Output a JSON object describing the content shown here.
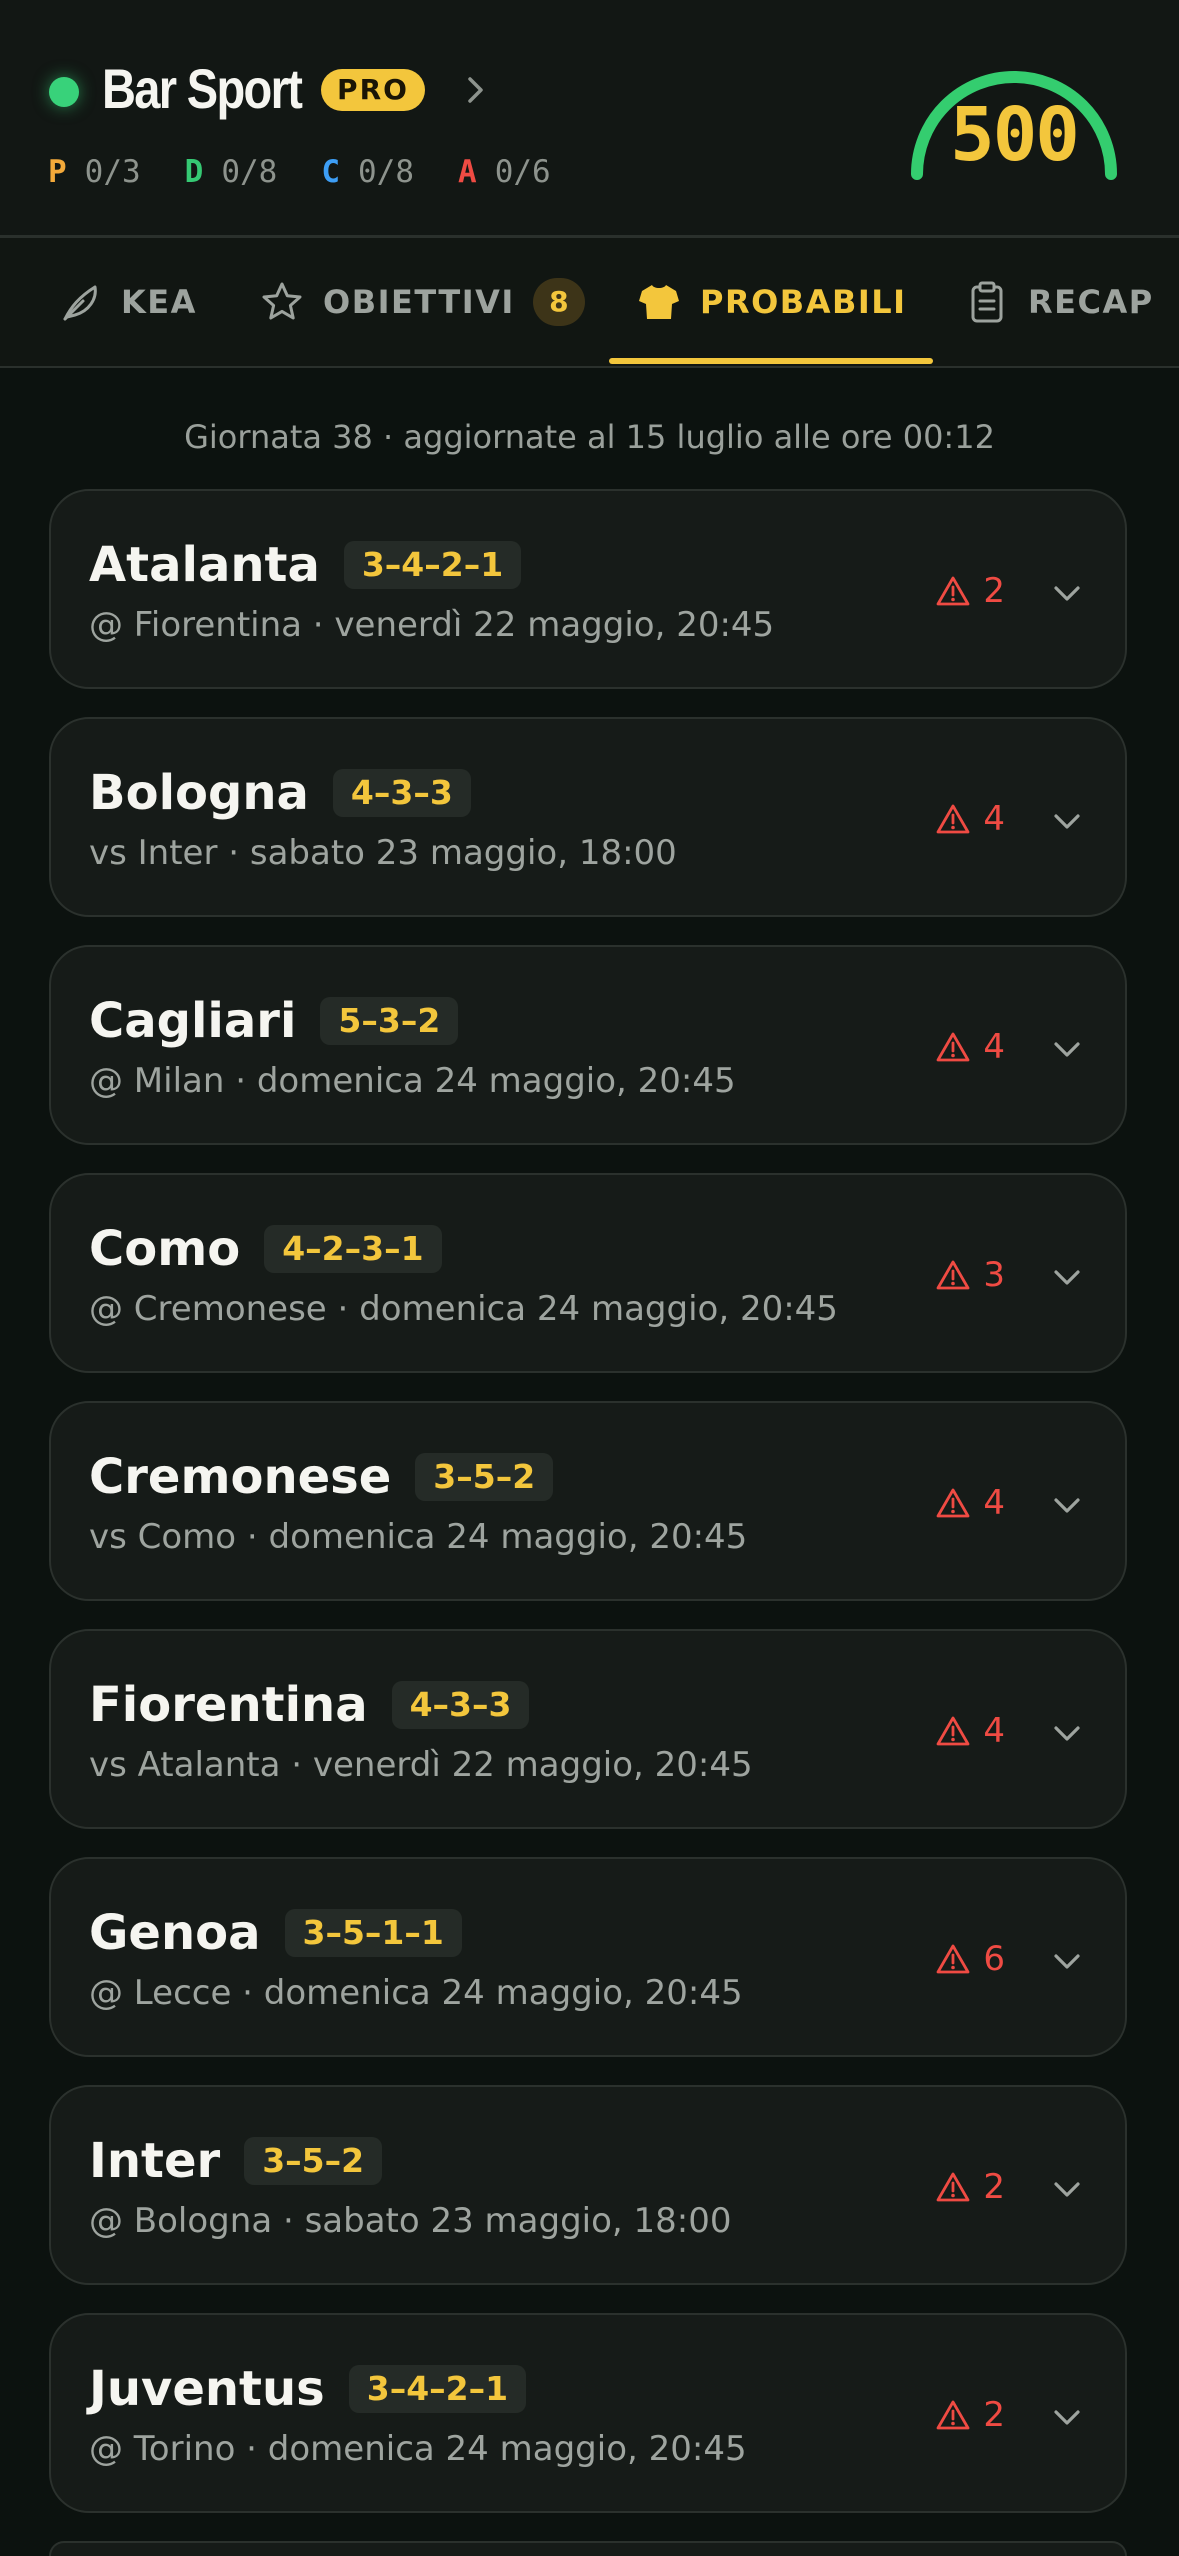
{
  "header": {
    "league_name": "Bar Sport",
    "badge": "PRO",
    "score": "500",
    "roles": [
      {
        "letter": "P",
        "value": "0/3",
        "color": "#f3a93a"
      },
      {
        "letter": "D",
        "value": "0/8",
        "color": "#35c973"
      },
      {
        "letter": "C",
        "value": "0/8",
        "color": "#3d9ef5"
      },
      {
        "letter": "A",
        "value": "0/6",
        "color": "#ef4b43"
      }
    ],
    "gauge_color": "#34cd6f"
  },
  "tabs": [
    {
      "label": "KEA",
      "icon": "feather-icon"
    },
    {
      "label": "OBIETTIVI",
      "icon": "star-icon",
      "count": "8"
    },
    {
      "label": "PROBABILI",
      "icon": "shirt-icon",
      "active": true
    },
    {
      "label": "RECAP",
      "icon": "clipboard-icon"
    }
  ],
  "info": "Giornata 38 · aggiornate al 15 luglio alle ore 00:12",
  "teams": [
    {
      "name": "Atalanta",
      "formation": "3–4–2–1",
      "match": "@ Fiorentina · venerdì 22 maggio, 20:45",
      "alerts": "2"
    },
    {
      "name": "Bologna",
      "formation": "4–3–3",
      "match": "vs Inter · sabato 23 maggio, 18:00",
      "alerts": "4"
    },
    {
      "name": "Cagliari",
      "formation": "5–3–2",
      "match": "@ Milan · domenica 24 maggio, 20:45",
      "alerts": "4"
    },
    {
      "name": "Como",
      "formation": "4–2–3–1",
      "match": "@ Cremonese · domenica 24 maggio, 20:45",
      "alerts": "3"
    },
    {
      "name": "Cremonese",
      "formation": "3–5–2",
      "match": "vs Como · domenica 24 maggio, 20:45",
      "alerts": "4"
    },
    {
      "name": "Fiorentina",
      "formation": "4–3–3",
      "match": "vs Atalanta · venerdì 22 maggio, 20:45",
      "alerts": "4"
    },
    {
      "name": "Genoa",
      "formation": "3–5–1–1",
      "match": "@ Lecce · domenica 24 maggio, 20:45",
      "alerts": "6"
    },
    {
      "name": "Inter",
      "formation": "3–5–2",
      "match": "@ Bologna · sabato 23 maggio, 18:00",
      "alerts": "2"
    },
    {
      "name": "Juventus",
      "formation": "3–4–2–1",
      "match": "@ Torino · domenica 24 maggio, 20:45",
      "alerts": "2"
    }
  ]
}
